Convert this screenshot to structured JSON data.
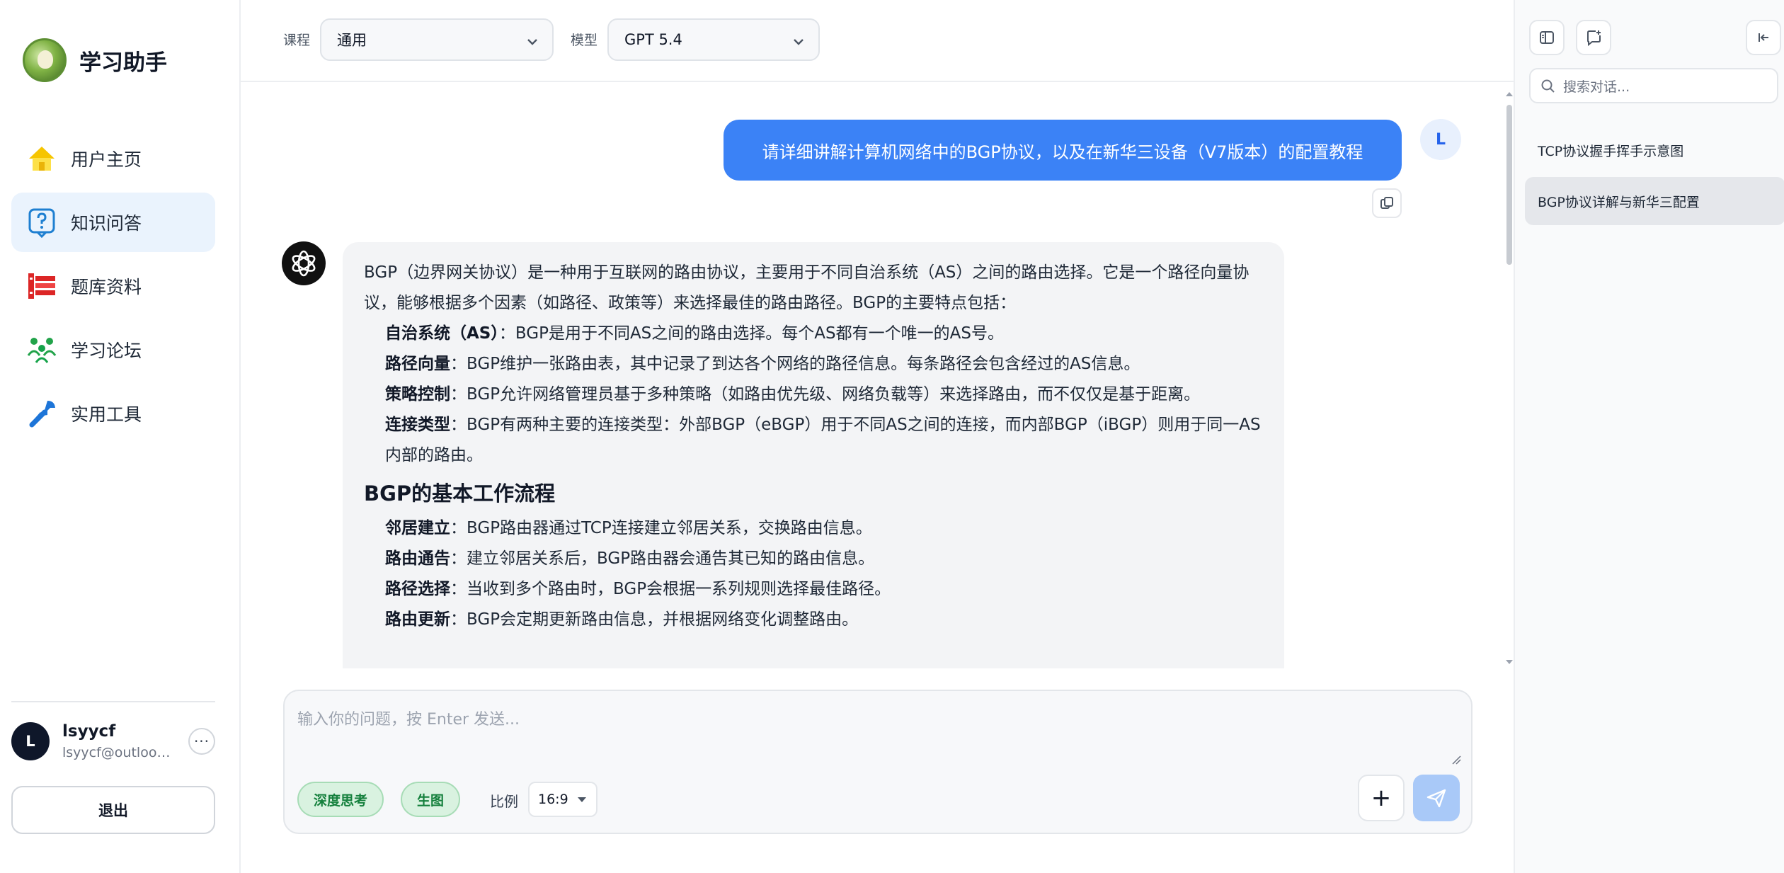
{
  "app": {
    "title": "学习助手"
  },
  "nav": [
    {
      "label": "用户主页",
      "icon": "home-icon",
      "active": false
    },
    {
      "label": "知识问答",
      "icon": "question-chat-icon",
      "active": true
    },
    {
      "label": "题库资料",
      "icon": "books-icon",
      "active": false
    },
    {
      "label": "学习论坛",
      "icon": "forum-people-icon",
      "active": false
    },
    {
      "label": "实用工具",
      "icon": "wrench-icon",
      "active": false
    }
  ],
  "user": {
    "initial": "L",
    "name": "lsyycf",
    "email": "lsyycf@outlook.com",
    "more": "···"
  },
  "logout_label": "退出",
  "topbar": {
    "course_label": "课程",
    "course_value": "通用",
    "model_label": "模型",
    "model_value": "GPT 5.4"
  },
  "chat": {
    "user_initial": "L",
    "user_message": "请详细讲解计算机网络中的BGP协议，以及在新华三设备（V7版本）的配置教程",
    "intro": "BGP（边界网关协议）是一种用于互联网的路由协议，主要用于不同自治系统（AS）之间的路由选择。它是一个路径向量协议，能够根据多个因素（如路径、政策等）来选择最佳的路由路径。BGP的主要特点包括：",
    "features": [
      {
        "term": "自治系统（AS）",
        "desc": "：BGP是用于不同AS之间的路由选择。每个AS都有一个唯一的AS号。"
      },
      {
        "term": "路径向量",
        "desc": "：BGP维护一张路由表，其中记录了到达各个网络的路径信息。每条路径会包含经过的AS信息。"
      },
      {
        "term": "策略控制",
        "desc": "：BGP允许网络管理员基于多种策略（如路由优先级、网络负载等）来选择路由，而不仅仅是基于距离。"
      },
      {
        "term": "连接类型",
        "desc": "：BGP有两种主要的连接类型：外部BGP（eBGP）用于不同AS之间的连接，而内部BGP（iBGP）则用于同一AS内部的路由。"
      }
    ],
    "section_heading": "BGP的基本工作流程",
    "workflow": [
      {
        "term": "邻居建立",
        "desc": "：BGP路由器通过TCP连接建立邻居关系，交换路由信息。"
      },
      {
        "term": "路由通告",
        "desc": "：建立邻居关系后，BGP路由器会通告其已知的路由信息。"
      },
      {
        "term": "路径选择",
        "desc": "：当收到多个路由时，BGP会根据一系列规则选择最佳路径。"
      },
      {
        "term": "路由更新",
        "desc": "：BGP会定期更新路由信息，并根据网络变化调整路由。"
      }
    ]
  },
  "composer": {
    "placeholder": "输入你的问题，按 Enter 发送...",
    "chip_think": "深度思考",
    "chip_image": "生图",
    "ratio_label": "比例",
    "ratio_value": "16:9",
    "plus": "+"
  },
  "right_panel": {
    "search_placeholder": "搜索对话...",
    "conversations": [
      {
        "title": "TCP协议握手挥手示意图",
        "active": false
      },
      {
        "title": "BGP协议详解与新华三配置",
        "active": true
      }
    ]
  },
  "colors": {
    "accent": "#3b82f6",
    "active_nav_bg": "#eaf3fd",
    "chip_bg": "#d9f2e0",
    "send_disabled": "#a9c9f8"
  }
}
